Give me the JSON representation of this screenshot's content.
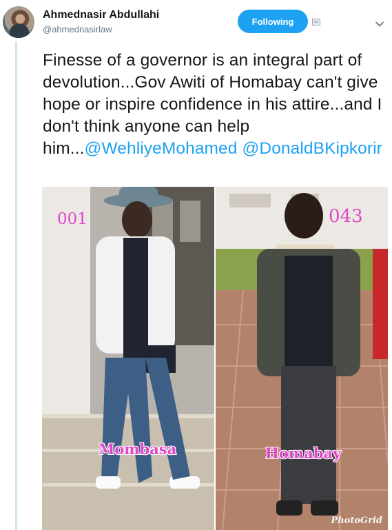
{
  "author": {
    "name": "Ahmednasir Abdullahi",
    "handle": "@ahmednasirlaw"
  },
  "follow_button": {
    "label": "Following"
  },
  "tweet": {
    "text": "Finesse of a governor is an integral part of devolution...Gov Awiti of Homabay can't give hope or inspire confidence in his attire...and I don't think anyone can help him...",
    "mention_1": "@WehliyeMohamed",
    "mention_2": "@DonaldBKipkorir"
  },
  "media": {
    "left": {
      "number": "001",
      "place": "Mombasa"
    },
    "right": {
      "number": "043",
      "place": "Homabay"
    },
    "watermark": "PhotoGrid"
  },
  "icons": {
    "notify": "notification-icon",
    "caret": "chevron-down-icon"
  },
  "colors": {
    "accent": "#1da1f2",
    "label": "#e046c9"
  }
}
